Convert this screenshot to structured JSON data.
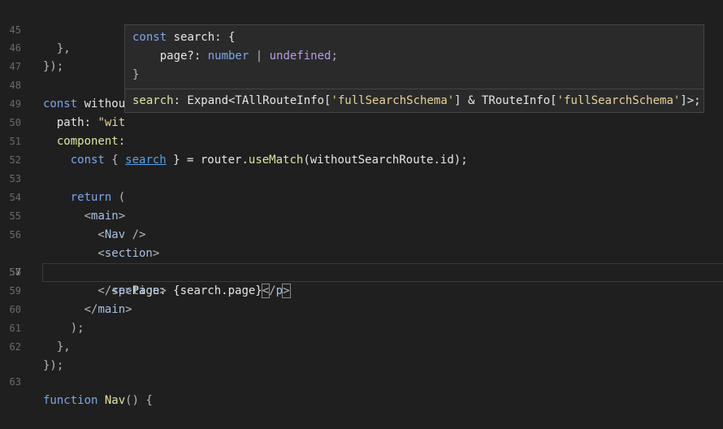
{
  "line_numbers": [
    "45",
    "46",
    "47",
    "48",
    "49",
    "50",
    "51",
    "52",
    "53",
    "54",
    "55",
    "56",
    "57",
    "58",
    "59",
    "60",
    "61",
    "62",
    "63"
  ],
  "code": {
    "l45": {
      "a": "  },"
    },
    "l46": {
      "a": "});"
    },
    "l48": {
      "kw": "const",
      "id": " without"
    },
    "l49": {
      "prop": "  path: ",
      "str": "\"wit"
    },
    "l50": {
      "prop": "  component:"
    },
    "l51": {
      "kw": "    const",
      "b1": " { ",
      "var": "search",
      "b2": " } = router.",
      "fn": "useMatch",
      "rest": "(withoutSearchRoute.id);"
    },
    "l53": {
      "kw": "    return",
      "rest": " ("
    },
    "l54": {
      "lt": "      <",
      "tag": "main",
      "gt": ">"
    },
    "l55": {
      "lt": "        <",
      "tag": "Nav",
      "gt": " />"
    },
    "l56": {
      "lt": "        <",
      "tag": "section",
      "gt": ">"
    },
    "l57": {
      "lt": "          <",
      "tag": "p",
      "gt": ">",
      "text": "Page: {search.page}",
      "lt2": "<",
      "sl": "/",
      "tag2": "p",
      "gt2": ">"
    },
    "l58": {
      "lt": "        </",
      "tag": "section",
      "gt": ">"
    },
    "l59": {
      "lt": "      </",
      "tag": "main",
      "gt": ">"
    },
    "l60": {
      "a": "    );"
    },
    "l61": {
      "a": "  },"
    },
    "l62": {
      "a": "});"
    },
    "l63": {
      "kw": "function",
      "fn": " Nav",
      "rest": "() {"
    }
  },
  "hover": {
    "line1_kw": "const",
    "line1_rest": " search: {",
    "line2_prop": "    page?: ",
    "line2_t1": "number",
    "line2_pipe": " | ",
    "line2_t2": "undefined",
    "line2_end": ";",
    "line3": "}",
    "sig_name": "search",
    "sig_a": ": Expand<TAllRouteInfo[",
    "sig_s1": "'fullSearchSchema'",
    "sig_b": "] & TRouteInfo[",
    "sig_s2": "'fullSearchSchema'",
    "sig_c": "]>;"
  },
  "colors": {
    "background": "#1f1f1f",
    "keyword": "#7da7e8",
    "function": "#dfe59c",
    "string": "#e7d29a",
    "link": "#56a3e8"
  }
}
